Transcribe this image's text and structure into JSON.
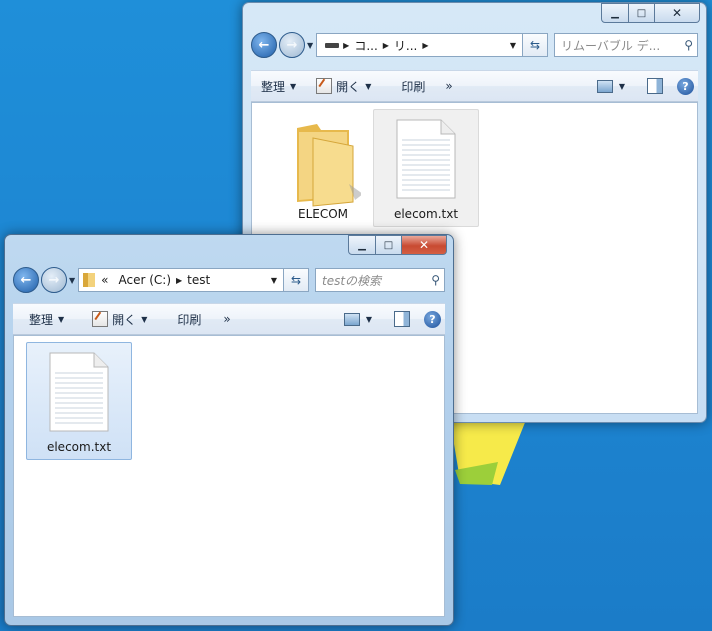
{
  "back_window": {
    "caption": {
      "minimize": "▁",
      "maximize": "□",
      "close": "✕"
    },
    "address": {
      "segments": [
        "コ...",
        "リ..."
      ]
    },
    "search_placeholder": "リムーバブル デ...",
    "toolbar": {
      "organize": "整理",
      "open": "開く",
      "print": "印刷",
      "more": "»"
    },
    "items": [
      {
        "name": "ELECOM",
        "icon": "folder-icon"
      },
      {
        "name": "elecom.txt",
        "icon": "text-document-icon"
      }
    ]
  },
  "front_window": {
    "caption": {
      "minimize": "▁",
      "maximize": "□",
      "close": "✕"
    },
    "address": {
      "prefix": "«",
      "segments": [
        "Acer (C:)",
        "test"
      ]
    },
    "search_placeholder": "testの検索",
    "toolbar": {
      "organize": "整理",
      "open": "開く",
      "print": "印刷",
      "more": "»"
    },
    "items": [
      {
        "name": "elecom.txt",
        "icon": "text-document-icon"
      }
    ]
  },
  "colors": {
    "desktop": "#1d86d2",
    "window_frame": "#b3d0ec",
    "selection": "#cfe1f6"
  }
}
